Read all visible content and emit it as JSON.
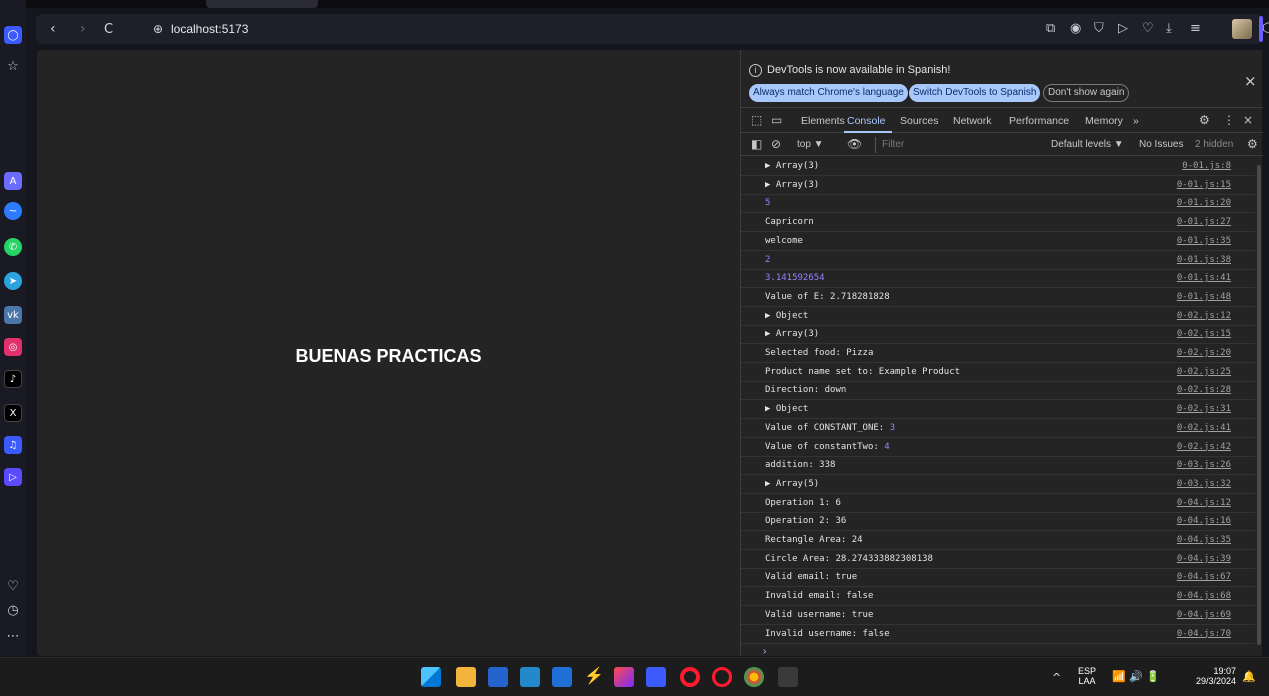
{
  "browser": {
    "url": "localhost:5173",
    "nav_back": "‹",
    "nav_forward": "›",
    "nav_reload": "C",
    "url_icon": "⊕",
    "toolbar_icons": [
      "snapshot-icon",
      "camera-icon",
      "shield-icon",
      "play-icon",
      "heart-icon",
      "download-icon",
      "menu-icon",
      "avatar",
      "cube-icon"
    ],
    "accent": "#6b5cff"
  },
  "page": {
    "title": "BUENAS PRACTICAS",
    "background": "#242424"
  },
  "devtools": {
    "notice": {
      "text": "DevTools is now available in Spanish!",
      "btn_match": "Always match Chrome's language",
      "btn_switch": "Switch DevTools to Spanish",
      "btn_dismiss": "Don't show again",
      "close": "×"
    },
    "tabs": {
      "elements": "Elements",
      "console": "Console",
      "sources": "Sources",
      "network": "Network",
      "performance": "Performance",
      "memory": "Memory",
      "more": "»",
      "close": "×"
    },
    "filterbar": {
      "context": "top ▼",
      "filter_placeholder": "Filter",
      "levels": "Default levels ▼",
      "issues": "No Issues",
      "hidden": "2 hidden"
    },
    "console_rows": [
      {
        "msg": "▶ Array(3)",
        "src": "0-01.js:8"
      },
      {
        "msg": "▶ Array(3)",
        "src": "0-01.js:15"
      },
      {
        "msg": "5",
        "src": "0-01.js:20",
        "numeric": true
      },
      {
        "msg": "Capricorn",
        "src": "0-01.js:27"
      },
      {
        "msg": "welcome",
        "src": "0-01.js:35"
      },
      {
        "msg": "2",
        "src": "0-01.js:38",
        "numeric": true
      },
      {
        "msg": "3.141592654",
        "src": "0-01.js:41",
        "numeric": true
      },
      {
        "msg": "Value of E: 2.718281828",
        "src": "0-01.js:48"
      },
      {
        "msg": "▶ Object",
        "src": "0-02.js:12"
      },
      {
        "msg": "▶ Array(3)",
        "src": "0-02.js:15"
      },
      {
        "msg": "Selected food: Pizza",
        "src": "0-02.js:20"
      },
      {
        "msg": "Product name set to: Example Product",
        "src": "0-02.js:25"
      },
      {
        "msg": "Direction: down",
        "src": "0-02.js:28"
      },
      {
        "msg": "▶ Object",
        "src": "0-02.js:31"
      },
      {
        "msg": "Value of CONSTANT_ONE:",
        "value": "3",
        "src": "0-02.js:41"
      },
      {
        "msg": "Value of constantTwo:",
        "value": "4",
        "src": "0-02.js:42"
      },
      {
        "msg": "addition: 338",
        "src": "0-03.js:26"
      },
      {
        "msg": "▶ Array(5)",
        "src": "0-03.js:32"
      },
      {
        "msg": "Operation 1: 6",
        "src": "0-04.js:12"
      },
      {
        "msg": "Operation 2: 36",
        "src": "0-04.js:16"
      },
      {
        "msg": "Rectangle Area: 24",
        "src": "0-04.js:35"
      },
      {
        "msg": "Circle Area: 28.274333882308138",
        "src": "0-04.js:39"
      },
      {
        "msg": "Valid email: true",
        "src": "0-04.js:67"
      },
      {
        "msg": "Invalid email: false",
        "src": "0-04.js:68"
      },
      {
        "msg": "Valid username: true",
        "src": "0-04.js:69"
      },
      {
        "msg": "Invalid username: false",
        "src": "0-04.js:70"
      }
    ],
    "prompt_caret": "›"
  },
  "taskbar": {
    "lang_top": "ESP",
    "lang_bottom": "LAA",
    "time": "19:07",
    "date": "29/3/2024",
    "tray_chevron": "^",
    "tray_icons": "📶 🔊 🔋"
  }
}
